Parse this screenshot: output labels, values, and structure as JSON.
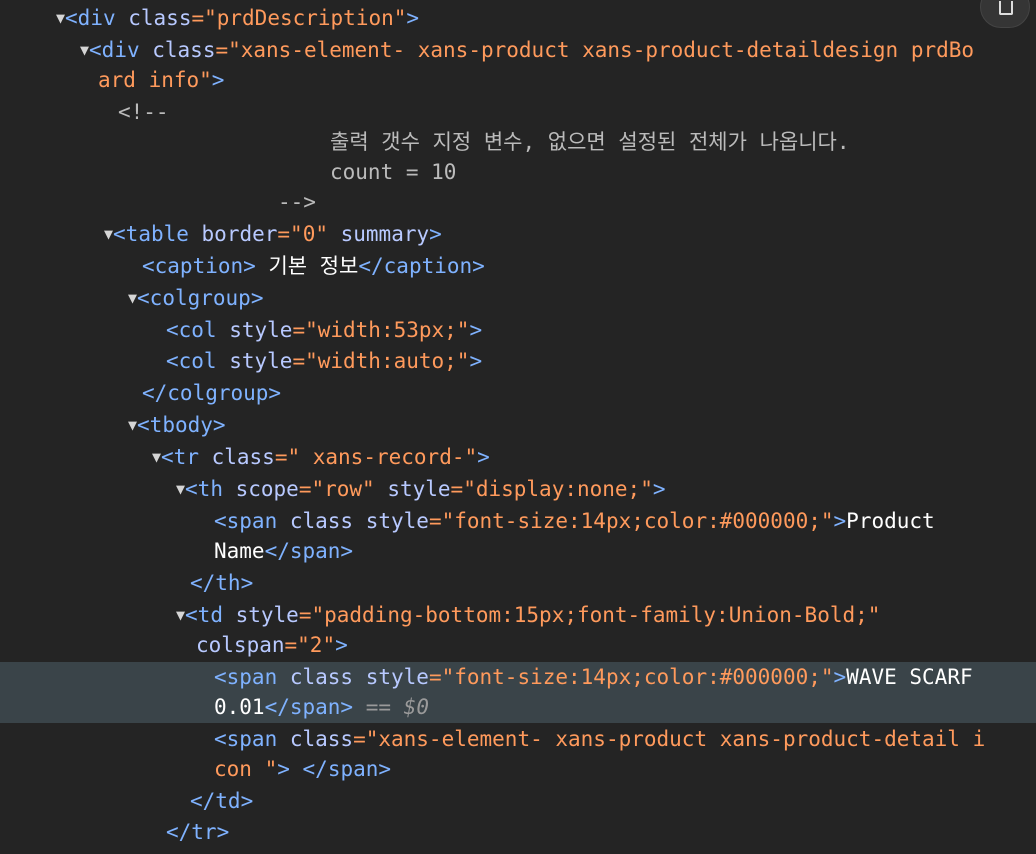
{
  "toggle_icon": "disclosure-triangle-icon",
  "lines": {
    "l1": {
      "tag_open": "<div",
      "a1": " class",
      "v1": "=\"prdDescription\"",
      "close": ">"
    },
    "l2": {
      "tag_open": "<div",
      "a1": " class",
      "v1": "=\"xans-element- xans-product xans-product-detaildesign prdBo"
    },
    "l3": {
      "v1": "ard info\"",
      "close": ">"
    },
    "l4": {
      "text": "<!--"
    },
    "l5": {
      "text": "출력 갯수 지정 변수, 없으면 설정된 전체가 나옵니다."
    },
    "l6": {
      "text": "count = 10"
    },
    "l7": {
      "text": "-->"
    },
    "l8": {
      "tag_open": "<table",
      "a1": " border",
      "v1": "=\"0\"",
      "a2": " summary",
      "close": ">"
    },
    "l9": {
      "tag_open": "<caption>",
      "text": " 기본 정보",
      "tag_close": "</caption>"
    },
    "l10": {
      "tag_open": "<colgroup>"
    },
    "l11": {
      "tag_open": "<col",
      "a1": " style",
      "v1": "=\"width:53px;\"",
      "close": ">"
    },
    "l12": {
      "tag_open": "<col",
      "a1": " style",
      "v1": "=\"width:auto;\"",
      "close": ">"
    },
    "l13": {
      "tag_close": "</colgroup>"
    },
    "l14": {
      "tag_open": "<tbody>"
    },
    "l15": {
      "tag_open": "<tr",
      "a1": " class",
      "v1": "=\" xans-record-\"",
      "close": ">"
    },
    "l16": {
      "tag_open": "<th",
      "a1": " scope",
      "v1": "=\"row\"",
      "a2": " style",
      "v2": "=\"display:none;\"",
      "close": ">"
    },
    "l17": {
      "tag_open": "<span",
      "a1": " class",
      "a2": " style",
      "v2": "=\"font-size:14px;color:#000000;\"",
      "close": ">",
      "text": "Product"
    },
    "l18": {
      "text": "Name",
      "tag_close": "</span>"
    },
    "l19": {
      "tag_close": "</th>"
    },
    "l20": {
      "tag_open": "<td",
      "a1": " style",
      "v1": "=\"padding-bottom:15px;font-family:Union-Bold;\""
    },
    "l21": {
      "a1": "colspan",
      "v1": "=\"2\"",
      "close": ">"
    },
    "l22": {
      "tag_open": "<span",
      "a1": " class",
      "a2": " style",
      "v2": "=\"font-size:14px;color:#000000;\"",
      "close": ">",
      "text": "WAVE SCARF"
    },
    "l23": {
      "text": "0.01",
      "tag_close": "</span>",
      "eq": " == ",
      "ref": "$0"
    },
    "l24": {
      "tag_open": "<span",
      "a1": " class",
      "v1": "=\"xans-element- xans-product xans-product-detail i"
    },
    "l25": {
      "v1": "con \"",
      "close": ">",
      "text": " ",
      "tag_close": "</span>"
    },
    "l26": {
      "tag_close": "</td>"
    },
    "l27": {
      "tag_close": "</tr>"
    }
  }
}
